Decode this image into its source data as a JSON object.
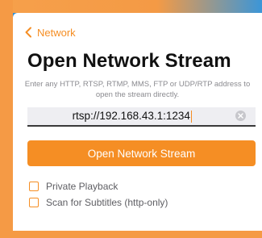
{
  "colors": {
    "accent": "#f58e24",
    "background_blue": "#2f8fd6",
    "panel": "#ffffff",
    "input_bg": "#eeeef2"
  },
  "nav": {
    "back_label": "Network",
    "back_icon": "chevron-left-icon"
  },
  "page": {
    "title": "Open Network Stream",
    "help_text": "Enter any HTTP, RTSP, RTMP, MMS, FTP or UDP/RTP address to open the stream directly."
  },
  "url_input": {
    "value": "rtsp://192.168.43.1:1234",
    "clear_icon": "clear-circle-x-icon"
  },
  "primary_button": {
    "label": "Open Network Stream"
  },
  "options": [
    {
      "label": "Private Playback",
      "checked": false
    },
    {
      "label": "Scan for Subtitles (http-only)",
      "checked": false
    }
  ]
}
